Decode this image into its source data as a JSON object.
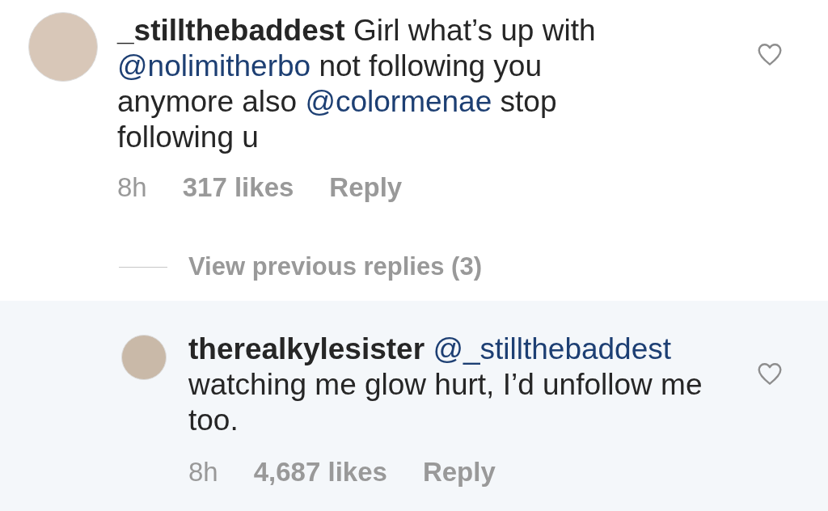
{
  "comments": [
    {
      "body": [
        {
          "kind": "username",
          "text": "_stillthebaddest"
        },
        {
          "kind": "text",
          "text": "Girl what’s up with"
        },
        {
          "kind": "mention",
          "text": "@nolimitherbo"
        },
        {
          "kind": "text",
          "text": "not following you anymore also"
        },
        {
          "kind": "mention",
          "text": "@colormenae"
        },
        {
          "kind": "text",
          "text": "stop following u"
        }
      ],
      "time": "8h",
      "likes": "317 likes",
      "reply": "Reply",
      "liked": false,
      "is_reply": false
    },
    {
      "body": [
        {
          "kind": "username",
          "text": "therealkylesister"
        },
        {
          "kind": "mention",
          "text": "@_stillthebaddest"
        },
        {
          "kind": "text",
          "text": "watching me glow hurt, I’d unfollow me too."
        }
      ],
      "time": "8h",
      "likes": "4,687 likes",
      "reply": "Reply",
      "liked": false,
      "is_reply": true
    }
  ],
  "view_replies": "View previous replies (3)"
}
